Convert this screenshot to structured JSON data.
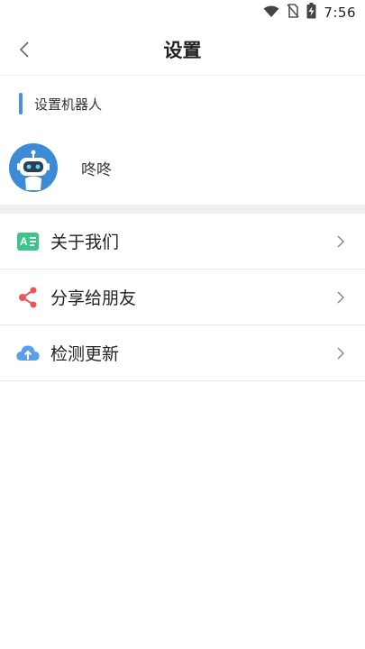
{
  "status_bar": {
    "time": "7:56",
    "icons": [
      "wifi-icon",
      "no-sim-icon",
      "battery-charging-icon"
    ]
  },
  "nav": {
    "title": "设置",
    "back_icon": "chevron-left-icon"
  },
  "section": {
    "label": "设置机器人",
    "accent_color": "#4a90e2"
  },
  "robot": {
    "name": "咚咚",
    "avatar_icon": "robot-icon",
    "avatar_color": "#3d8ad6"
  },
  "menu": {
    "items": [
      {
        "label": "关于我们",
        "icon": "about-card-icon",
        "icon_color": "#3cc48b"
      },
      {
        "label": "分享给朋友",
        "icon": "share-icon",
        "icon_color": "#e8575a"
      },
      {
        "label": "检测更新",
        "icon": "cloud-upload-icon",
        "icon_color": "#5aa0e8"
      }
    ]
  }
}
